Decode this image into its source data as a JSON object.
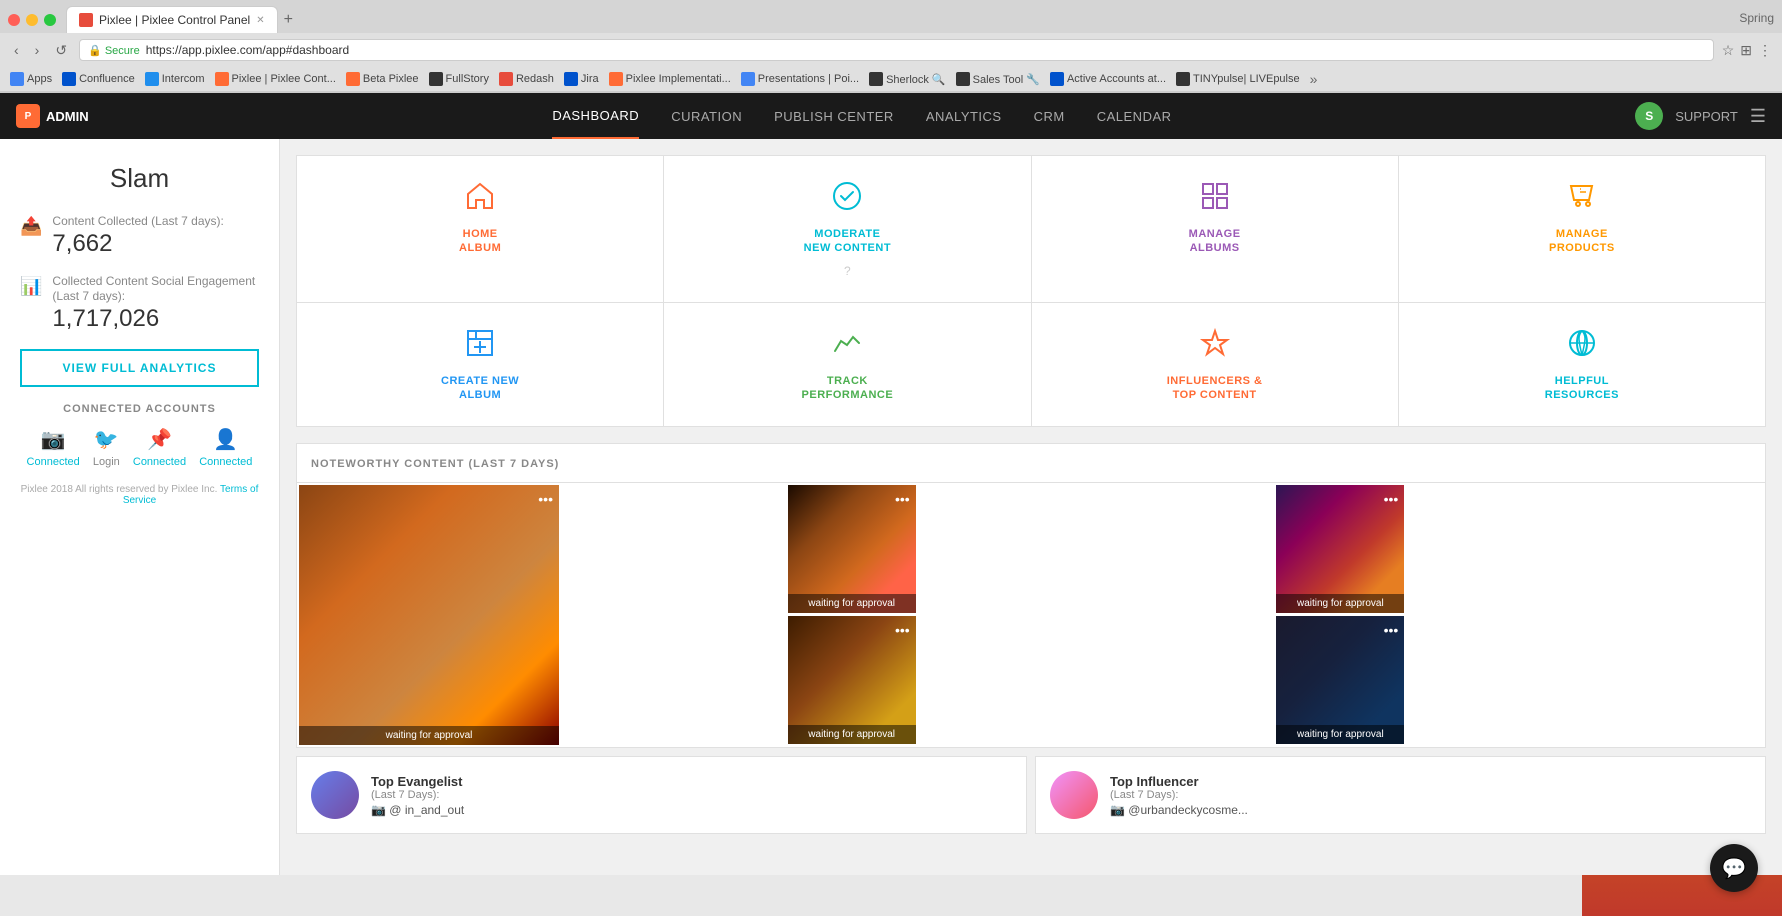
{
  "browser": {
    "tab_title": "Pixlee | Pixlee Control Panel",
    "url": "https://app.pixlee.com/app#dashboard",
    "spring_label": "Spring",
    "bookmarks": [
      {
        "label": "Apps",
        "color": "#4285F4"
      },
      {
        "label": "Confluence",
        "color": "#0052CC"
      },
      {
        "label": "Intercom",
        "color": "#1F8EED"
      },
      {
        "label": "Pixlee | Pixlee Cont...",
        "color": "#FF6B35"
      },
      {
        "label": "Beta Pixlee",
        "color": "#FF6B35"
      },
      {
        "label": "FullStory",
        "color": "#333"
      },
      {
        "label": "Redash",
        "color": "#e74c3c"
      },
      {
        "label": "Jira",
        "color": "#0052CC"
      },
      {
        "label": "Pixlee Implementati...",
        "color": "#FF6B35"
      },
      {
        "label": "Presentations | Poi...",
        "color": "#4285F4"
      },
      {
        "label": "Sherlock 🔍",
        "color": "#333"
      },
      {
        "label": "Sales Tool 🔧",
        "color": "#333"
      },
      {
        "label": "Active Accounts at...",
        "color": "#0052CC"
      },
      {
        "label": "TINYpulse| LIVEpulse",
        "color": "#333"
      }
    ]
  },
  "navbar": {
    "logo_text": "ADMIN",
    "links": [
      {
        "label": "DASHBOARD",
        "active": true
      },
      {
        "label": "CURATION",
        "active": false
      },
      {
        "label": "PUBLISH CENTER",
        "active": false
      },
      {
        "label": "ANALYTICS",
        "active": false
      },
      {
        "label": "CRM",
        "active": false
      },
      {
        "label": "CALENDAR",
        "active": false
      }
    ],
    "support_label": "SUPPORT",
    "avatar_letter": "S"
  },
  "sidebar": {
    "account_name": "Slam",
    "stats": [
      {
        "label": "Content Collected (Last 7 days):",
        "value": "7,662"
      },
      {
        "label": "Collected Content Social Engagement (Last 7 days):",
        "value": "1,717,026"
      }
    ],
    "analytics_btn": "VIEW FULL ANALYTICS",
    "connected_accounts_label": "CONNECTED ACCOUNTS",
    "social": [
      {
        "platform": "instagram",
        "status": "Connected",
        "connected": true
      },
      {
        "platform": "twitter",
        "status": "Login",
        "connected": false
      },
      {
        "platform": "pinterest",
        "status": "Connected",
        "connected": true
      },
      {
        "platform": "facebook",
        "status": "Connected",
        "connected": true
      }
    ],
    "footer": "Pixlee 2018 All rights reserved by Pixlee Inc.",
    "terms_label": "Terms of Service"
  },
  "actions": [
    {
      "id": "home-album",
      "label": "HOME\nALBUM",
      "icon": "🏠",
      "color_class": "icon-home"
    },
    {
      "id": "moderate",
      "label": "MODERATE\nNEW CONTENT",
      "icon": "✅",
      "color_class": "icon-moderate"
    },
    {
      "id": "manage-albums",
      "label": "MANAGE\nALBUMS",
      "icon": "⊞",
      "color_class": "icon-albums"
    },
    {
      "id": "manage-products",
      "label": "MANAGE\nPRODUCTS",
      "icon": "🏷",
      "color_class": "icon-products"
    },
    {
      "id": "create-album",
      "label": "CREATE NEW\nALBUM",
      "icon": "📋",
      "color_class": "icon-create"
    },
    {
      "id": "track",
      "label": "TRACK\nPERFORMANCE",
      "icon": "📈",
      "color_class": "icon-track"
    },
    {
      "id": "influencers",
      "label": "INFLUENCERS &\nTOP CONTENT",
      "icon": "⭐",
      "color_class": "icon-influencers"
    },
    {
      "id": "resources",
      "label": "HELPFUL\nRESOURCES",
      "icon": "🌐",
      "color_class": "icon-resources"
    }
  ],
  "noteworthy": {
    "title": "NOTEWORTHY CONTENT (LAST 7 DAYS)",
    "items": [
      {
        "id": "palette",
        "large": true,
        "overlay": "waiting for approval",
        "bg_class": "palette-bg"
      },
      {
        "id": "eye",
        "large": false,
        "overlay": "waiting for approval",
        "bg_class": "eye-bg"
      },
      {
        "id": "naked",
        "large": false,
        "overlay": "waiting for approval",
        "bg_class": "naked-bg"
      },
      {
        "id": "face",
        "large": false,
        "overlay": "waiting for approval",
        "bg_class": "face-bg"
      },
      {
        "id": "brow",
        "large": false,
        "overlay": "waiting for approval",
        "bg_class": "brow-bg"
      }
    ]
  },
  "bottom": {
    "evangelist": {
      "title": "Top Evangelist",
      "subtitle": "(Last 7 Days):",
      "handle": "@ in_and_out"
    },
    "influencer": {
      "title": "Top Influencer",
      "subtitle": "(Last 7 Days):",
      "handle": "@urbandeckycosme..."
    }
  }
}
